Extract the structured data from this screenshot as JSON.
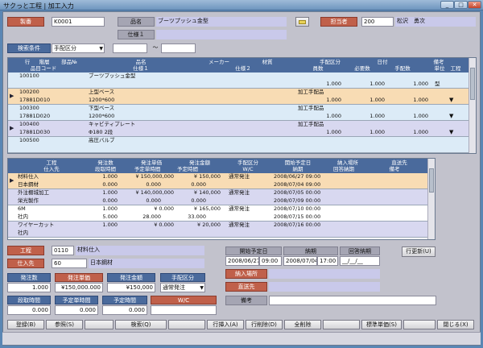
{
  "window": {
    "title": "サクっと工程 | 加工入力"
  },
  "header": {
    "seiban_label": "製番",
    "seiban_value": "K0001",
    "hinmei_label": "品名",
    "hinmei_value": "ブーツプッシュ金型",
    "shiyo_label": "仕様１",
    "shiyo_value": "",
    "tanto_label": "担当者",
    "tanto_code": "200",
    "tanto_name": "松沢　勇次",
    "search_label": "検索条件",
    "search_value": "手配区分",
    "range_from": "",
    "range_sep": "～",
    "range_to": ""
  },
  "grid1": {
    "head1": [
      "行",
      "階層",
      "部品№",
      "品名",
      "メーカー",
      "材質",
      "手配区分",
      "日付",
      "備考"
    ],
    "head2": [
      "品目コード",
      "仕様１",
      "仕様２",
      "員数",
      "必要数",
      "手配数",
      "単位",
      "工程"
    ],
    "rows": [
      {
        "line": "100100",
        "code": "",
        "name": "ブーツプッシュ金型",
        "shiyo1": "",
        "tehai": "",
        "qty": "1.000",
        "need": "1.000",
        "order": "1.000",
        "unit": "型",
        "koutei": "",
        "sel": "",
        "dd": "",
        "band": "blue"
      },
      {
        "line": "100200",
        "code": "17881D010",
        "name": "上型ベース",
        "shiyo1": "1200*600",
        "tehai": "加工手配品",
        "qty": "1.000",
        "need": "1.000",
        "order": "1.000",
        "unit": "",
        "koutei": "",
        "sel": "▶",
        "dd": "▼",
        "band": "orange"
      },
      {
        "line": "100300",
        "code": "17881D020",
        "name": "下型ベース",
        "shiyo1": "1200*600",
        "tehai": "加工手配品",
        "qty": "1.000",
        "need": "1.000",
        "order": "1.000",
        "unit": "",
        "koutei": "",
        "sel": "",
        "dd": "▼",
        "band": "blue"
      },
      {
        "line": "100400",
        "code": "17881D030",
        "name": "キャビティプレート",
        "shiyo1": "Φ180 2段",
        "tehai": "加工手配品",
        "qty": "1.000",
        "need": "1.000",
        "order": "1.000",
        "unit": "",
        "koutei": "",
        "sel": "▶",
        "dd": "▼",
        "band": "lav"
      },
      {
        "line": "100500",
        "code": "",
        "name": "高圧バルブ",
        "shiyo1": "",
        "tehai": "",
        "qty": "",
        "need": "",
        "order": "",
        "unit": "",
        "koutei": "",
        "sel": "",
        "dd": "",
        "band": "blue"
      }
    ]
  },
  "grid2": {
    "head1": [
      "工程",
      "発注数",
      "発注単価",
      "発注金額",
      "手配区分",
      "開始予定日",
      "納入場所",
      "直送先"
    ],
    "head2": [
      "仕入先",
      "段取時間",
      "予定単時間",
      "予定時間",
      "W/C",
      "納期",
      "回答納期",
      "備考"
    ],
    "rows": [
      {
        "koutei": "材料仕入",
        "shiire": "日本鋼材",
        "qty": "1.000",
        "price": "¥ 150,000,000",
        "amount": "¥ 150,000",
        "tehai": "通常発注",
        "start": "2008/06/27 09:00",
        "due": "2008/07/04 09:00",
        "dan": "0.000",
        "yotei_t": "0.000",
        "yotei": "0.000",
        "sel": "▶",
        "band": "orange"
      },
      {
        "koutei": "外注棚城加工",
        "shiire": "栄光製作",
        "qty": "1.000",
        "price": "¥ 140,000,000",
        "amount": "¥ 140,000",
        "tehai": "通常発注",
        "start": "2008/07/05 00:00",
        "due": "2008/07/09 00:00",
        "dan": "0.000",
        "yotei_t": "0.000",
        "yotei": "0.000",
        "sel": "",
        "band": "lav"
      },
      {
        "koutei": "6M",
        "shiire": "社内",
        "qty": "1.000",
        "price": "¥ 0.000",
        "amount": "¥ 165,000",
        "tehai": "通常発注",
        "start": "2008/07/10 00:00",
        "due": "2008/07/15 00:00",
        "dan": "5.000",
        "yotei_t": "28.000",
        "yotei": "33.000",
        "sel": "",
        "band": "white"
      },
      {
        "koutei": "ワイヤーカット",
        "shiire": "社内",
        "qty": "1.000",
        "price": "¥ 0.000",
        "amount": "¥ 20,000",
        "tehai": "通常発注",
        "start": "2008/07/16 00:00",
        "due": "",
        "dan": "",
        "yotei_t": "",
        "yotei": "",
        "sel": "",
        "band": "lav"
      }
    ]
  },
  "detail": {
    "koutei_label": "工程",
    "koutei_code": "0110",
    "koutei_name": "材料仕入",
    "shiire_label": "仕入先",
    "shiire_code": "60",
    "shiire_name": "日本鋼材",
    "start_label": "開始予定日",
    "start_date": "2008/06/27",
    "start_time": "09:00",
    "due_label": "納期",
    "due_date": "2008/07/04",
    "due_time": "17:00",
    "answer_label": "回答納期",
    "answer_value": "__/__/__",
    "update_btn": "行更新(U)",
    "qty_label": "発注数",
    "qty_value": "1.000",
    "price_label": "発注単価",
    "price_value": "¥150,000.000",
    "amount_label": "発注金額",
    "amount_value": "¥150,000",
    "tehai_label": "手配区分",
    "tehai_value": "通常発注",
    "place_label": "納入場所",
    "place_value": "",
    "direct_label": "直送先",
    "direct_value": "",
    "dan_label": "段取時間",
    "dan_value": "0.000",
    "ytan_label": "予定単時間",
    "ytan_value": "0.000",
    "yotei_label": "予定時間",
    "yotei_value": "0.000",
    "wc_label": "W/C",
    "wc_value": "",
    "biko_label": "備考",
    "biko_value": ""
  },
  "footer": {
    "buttons": [
      "登録(B)",
      "参照(S)",
      "",
      "検索(Q)",
      "",
      "行挿入(A)",
      "行削除(D)",
      "全削除",
      "",
      "標準単価(S)",
      "",
      "閉じる(X)"
    ]
  },
  "colors": {
    "accent_red": "#c0604a",
    "header_blue": "#4a6a9c",
    "row_orange": "#f8dcb4",
    "row_lav": "#d8d8f0",
    "row_blue": "#dcebf7"
  }
}
